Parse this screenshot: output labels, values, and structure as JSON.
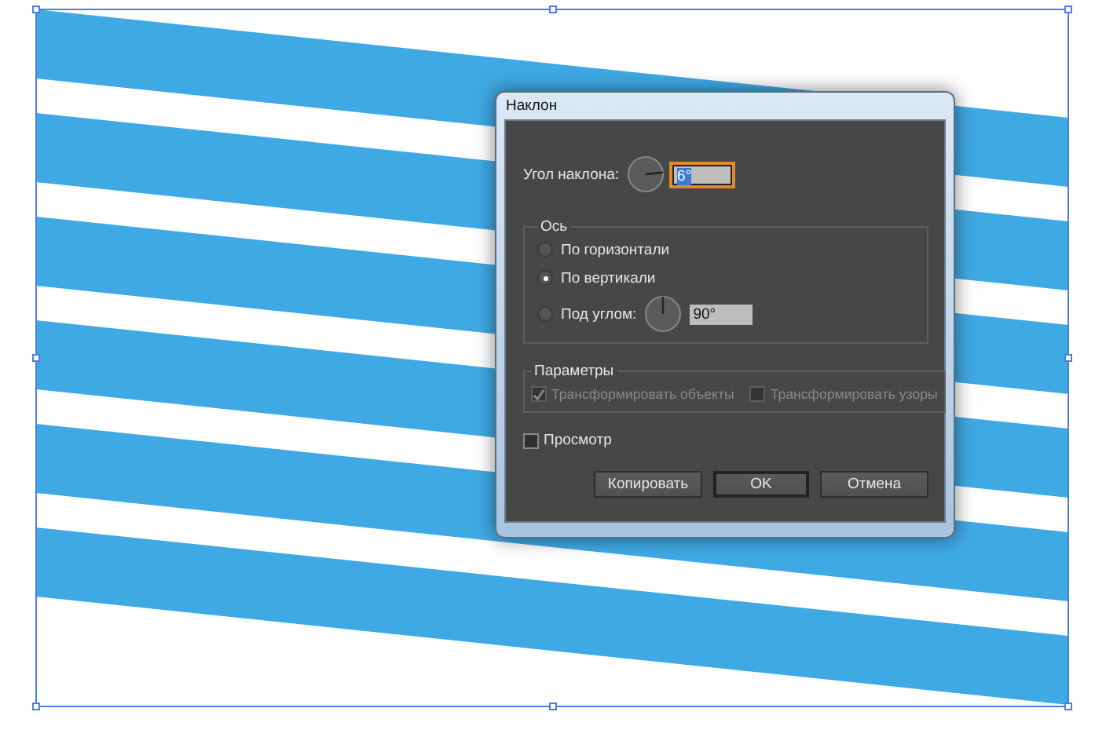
{
  "window": {
    "title": "Наклон"
  },
  "angle": {
    "label": "Угол наклона:",
    "value": "6°"
  },
  "axis": {
    "title": "Ось",
    "options": [
      {
        "label": "По горизонтали",
        "selected": false
      },
      {
        "label": "По вертикали",
        "selected": true
      },
      {
        "label": "Под углом:",
        "selected": false,
        "value": "90°"
      }
    ]
  },
  "options": {
    "title": "Параметры",
    "items": [
      {
        "label": "Трансформировать объекты",
        "checked": true,
        "disabled": true
      },
      {
        "label": "Трансформировать узоры",
        "checked": false,
        "disabled": true
      }
    ]
  },
  "preview": {
    "label": "Просмотр",
    "checked": false
  },
  "buttons": [
    {
      "label": "Копировать",
      "default": false
    },
    {
      "label": "OK",
      "default": true
    },
    {
      "label": "Отмена",
      "default": false
    }
  ]
}
